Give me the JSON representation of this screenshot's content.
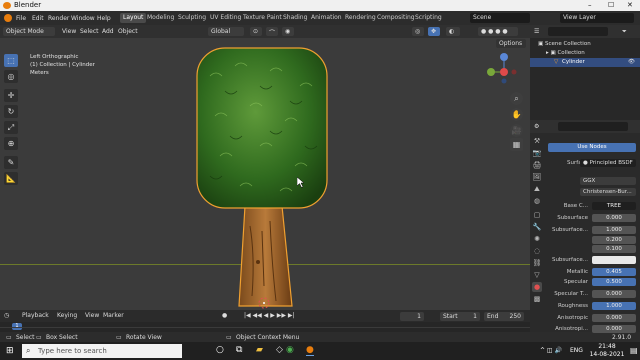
{
  "window": {
    "title": "Blender",
    "minimize": "–",
    "maximize": "☐",
    "close": "✕"
  },
  "menus": [
    "File",
    "Edit",
    "Render",
    "Window",
    "Help"
  ],
  "workspaces": [
    "Layout",
    "Modeling",
    "Sculpting",
    "UV Editing",
    "Texture Paint",
    "Shading",
    "Animation",
    "Rendering",
    "Compositing",
    "Scripting"
  ],
  "scene": {
    "name": "Scene",
    "view_layer": "View Layer"
  },
  "viewport_header": {
    "mode": "Object Mode",
    "view": "View",
    "select": "Select",
    "add": "Add",
    "object": "Object",
    "orientation": "Global",
    "options": "Options"
  },
  "viewport_info": {
    "line1": "Left Orthographic",
    "line2": "(1) Collection | Cylinder",
    "line3": "Meters"
  },
  "gizmo": {
    "z": "Z",
    "x": "X",
    "y": "Y"
  },
  "outliner": {
    "scene_collection": "Scene Collection",
    "collection": "Collection",
    "cylinder": "Cylinder"
  },
  "properties": {
    "search_placeholder": "",
    "use_nodes": "Use Nodes",
    "surface_label": "Surface",
    "surface_value": "Principled BSDF",
    "distribution": "GGX",
    "subsurface_method": "Christensen-Bur...",
    "rows": [
      {
        "label": "Base C...",
        "value": "TREE",
        "style": "dark"
      },
      {
        "label": "Subsurface",
        "value": "0.000",
        "style": "grey"
      },
      {
        "label": "Subsurface...",
        "value": "1.000",
        "style": "grey"
      },
      {
        "label": "",
        "value": "0.200",
        "style": "grey"
      },
      {
        "label": "",
        "value": "0.100",
        "style": "grey"
      },
      {
        "label": "Subsurface...",
        "value": "",
        "style": "white"
      },
      {
        "label": "Metallic",
        "value": "0.405",
        "style": "blue"
      },
      {
        "label": "Specular",
        "value": "0.500",
        "style": "blue"
      },
      {
        "label": "Specular T...",
        "value": "0.000",
        "style": "grey"
      },
      {
        "label": "Roughness",
        "value": "1.000",
        "style": "blue"
      },
      {
        "label": "Anisotropic",
        "value": "0.000",
        "style": "grey"
      },
      {
        "label": "Anisotropi...",
        "value": "0.000",
        "style": "grey"
      }
    ]
  },
  "timeline": {
    "playback": "Playback",
    "keying": "Keying",
    "view": "View",
    "marker": "Marker",
    "current_frame": "1",
    "start_label": "Start",
    "start": "1",
    "end_label": "End",
    "end": "250",
    "ruler_marker": "1"
  },
  "statusbar": {
    "select": "Select",
    "box_select": "Box Select",
    "rotate_view": "Rotate View",
    "context_menu": "Object Context Menu",
    "version": "2.91.0"
  },
  "taskbar": {
    "search_placeholder": "Type here to search",
    "time": "21:48",
    "date": "14-08-2021",
    "lang": "ENG"
  },
  "colors": {
    "accent": "#4772b3",
    "selection": "#f0a030",
    "background": "#3b3b3b"
  }
}
